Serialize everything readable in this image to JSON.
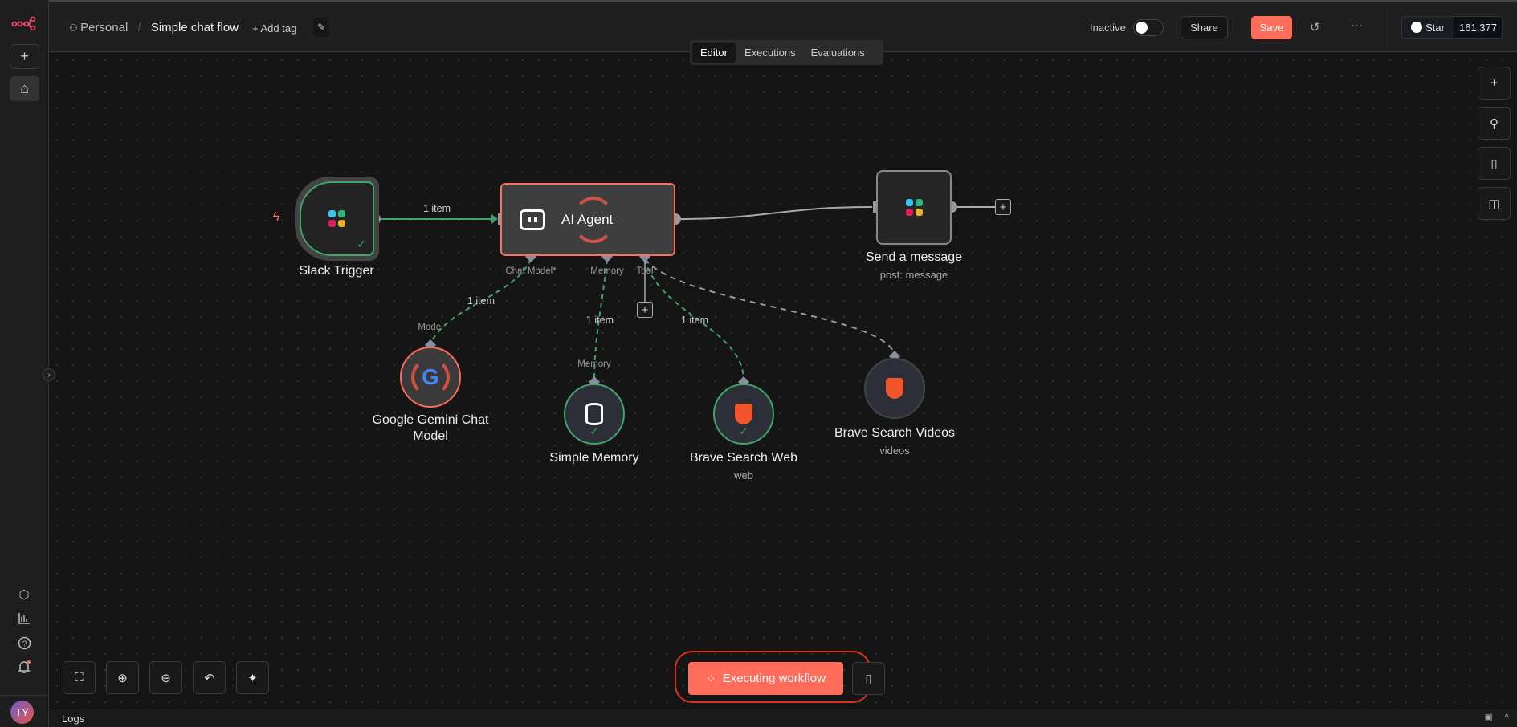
{
  "header": {
    "project": "Personal",
    "workflow_name": "Simple chat flow",
    "add_tag": "+ Add tag",
    "status_label": "Inactive",
    "share": "Share",
    "save": "Save",
    "github_star": "Star",
    "github_count": "161,377"
  },
  "tabs": [
    {
      "label": "Editor",
      "active": true
    },
    {
      "label": "Executions"
    },
    {
      "label": "Evaluations"
    }
  ],
  "nodes": {
    "slack_trigger": {
      "label": "Slack Trigger"
    },
    "ai_agent": {
      "label": "AI Agent",
      "handles": [
        "Chat Model*",
        "Memory",
        "Tool"
      ]
    },
    "send_message": {
      "label": "Send a message",
      "sub": "post: message"
    },
    "gemini": {
      "label_line1": "Google Gemini Chat",
      "label_line2": "Model",
      "input": "Model"
    },
    "memory": {
      "label": "Simple Memory",
      "input": "Memory"
    },
    "brave_web": {
      "label": "Brave Search Web",
      "sub": "web"
    },
    "brave_videos": {
      "label": "Brave Search Videos",
      "sub": "videos"
    }
  },
  "edges": {
    "trigger_to_agent": "1 item",
    "model": "1 item",
    "memory": "1 item",
    "tool_web": "1 item"
  },
  "execute_button": "Executing workflow",
  "logs_label": "Logs",
  "user_initials": "TY",
  "colors": {
    "accent": "#ff6d5a",
    "success": "#3fa56b",
    "bg": "#151515"
  }
}
